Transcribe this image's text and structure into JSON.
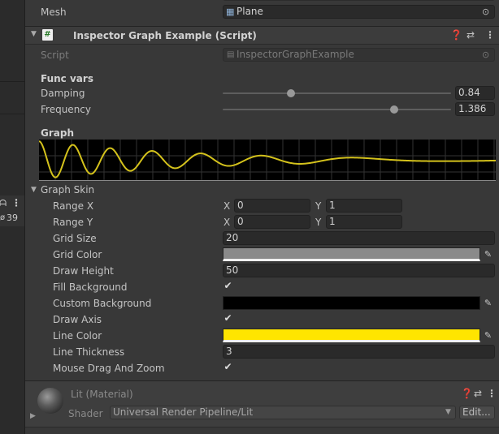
{
  "left_panel": {
    "status_count": "39"
  },
  "mesh_row": {
    "label": "Mesh",
    "value": "Plane"
  },
  "component": {
    "title": "Inspector Graph Example (Script)",
    "script_label": "Script",
    "script_value": "InspectorGraphExample"
  },
  "func_vars": {
    "heading": "Func vars",
    "damping_label": "Damping",
    "damping_value": "0.84",
    "damping_fraction": 0.29,
    "frequency_label": "Frequency",
    "frequency_value": "1.386",
    "frequency_fraction": 0.76
  },
  "graph": {
    "heading": "Graph",
    "line_color": "#d4c21c",
    "grid_color": "#333333",
    "background_color": "#000000"
  },
  "graph_skin": {
    "heading": "Graph Skin",
    "range_x_label": "Range X",
    "range_x_x_label": "X",
    "range_x_x": "0",
    "range_x_y_label": "Y",
    "range_x_y": "1",
    "range_y_label": "Range Y",
    "range_y_x_label": "X",
    "range_y_x": "0",
    "range_y_y_label": "Y",
    "range_y_y": "1",
    "grid_size_label": "Grid Size",
    "grid_size_value": "20",
    "grid_color_label": "Grid Color",
    "grid_color_value": "#8a8a8a",
    "draw_height_label": "Draw Height",
    "draw_height_value": "50",
    "fill_background_label": "Fill Background",
    "fill_background_checked": true,
    "custom_background_label": "Custom Background",
    "custom_background_value": "#000000",
    "draw_axis_label": "Draw Axis",
    "draw_axis_checked": true,
    "line_color_label": "Line Color",
    "line_color_value": "#ffe500",
    "line_thickness_label": "Line Thickness",
    "line_thickness_value": "3",
    "mouse_drag_label": "Mouse Drag And Zoom",
    "mouse_drag_checked": true
  },
  "material": {
    "title": "Lit (Material)",
    "shader_label": "Shader",
    "shader_value": "Universal Render Pipeline/Lit",
    "edit_label": "Edit..."
  }
}
